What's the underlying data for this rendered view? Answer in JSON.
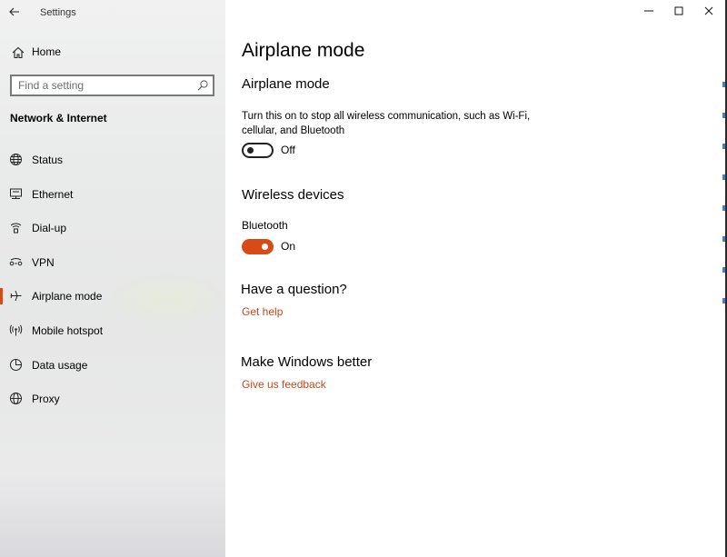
{
  "window": {
    "app_title": "Settings"
  },
  "sidebar": {
    "home_label": "Home",
    "search": {
      "placeholder": "Find a setting",
      "value": ""
    },
    "section_title": "Network & Internet",
    "items": [
      {
        "label": "Status",
        "icon": "globe-status-icon",
        "selected": false
      },
      {
        "label": "Ethernet",
        "icon": "ethernet-icon",
        "selected": false
      },
      {
        "label": "Dial-up",
        "icon": "dial-up-icon",
        "selected": false
      },
      {
        "label": "VPN",
        "icon": "vpn-icon",
        "selected": false
      },
      {
        "label": "Airplane mode",
        "icon": "airplane-icon",
        "selected": true
      },
      {
        "label": "Mobile hotspot",
        "icon": "hotspot-icon",
        "selected": false
      },
      {
        "label": "Data usage",
        "icon": "data-usage-icon",
        "selected": false
      },
      {
        "label": "Proxy",
        "icon": "proxy-globe-icon",
        "selected": false
      }
    ]
  },
  "main": {
    "page_title": "Airplane mode",
    "airplane": {
      "heading": "Airplane mode",
      "description": "Turn this on to stop all wireless communication, such as Wi-Fi, cellular, and Bluetooth",
      "toggle_state": "Off",
      "toggle_on": false
    },
    "wireless": {
      "heading": "Wireless devices",
      "bluetooth_label": "Bluetooth",
      "toggle_state": "On",
      "toggle_on": true
    },
    "question": {
      "heading": "Have a question?",
      "link": "Get help"
    },
    "better": {
      "heading": "Make Windows better",
      "link": "Give us feedback"
    }
  },
  "colors": {
    "accent": "#d84b16",
    "link": "#c8461a",
    "sidebar_bg": "#e9eaea"
  }
}
